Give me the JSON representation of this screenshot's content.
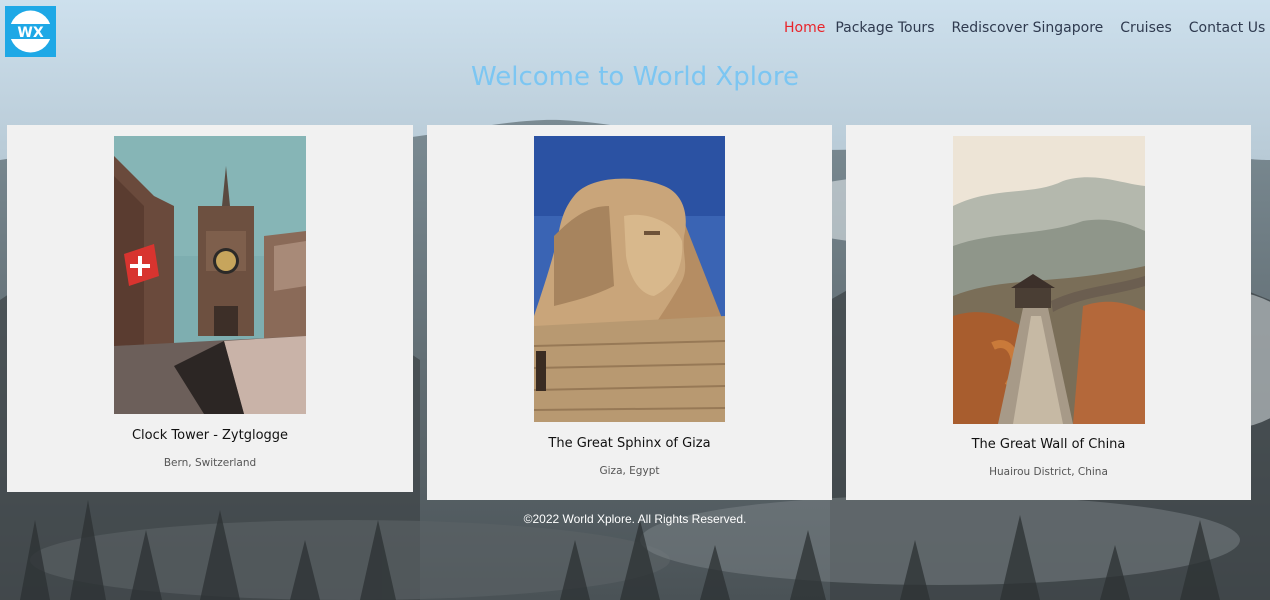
{
  "brand": {
    "logo_text": "WX"
  },
  "nav": {
    "items": [
      {
        "label": "Home",
        "active": true
      },
      {
        "label": "Package Tours"
      },
      {
        "label": "Rediscover Singapore"
      },
      {
        "label": "Cruises"
      },
      {
        "label": "Contact Us"
      }
    ]
  },
  "page": {
    "title": "Welcome to World Xplore"
  },
  "cards": [
    {
      "name": "Clock Tower - Zytglogge",
      "location": "Bern, Switzerland"
    },
    {
      "name": "The Great Sphinx of Giza",
      "location": "Giza, Egypt"
    },
    {
      "name": "The Great Wall of China",
      "location": "Huairou District, China"
    }
  ],
  "footer": {
    "copyright": "©2022 World Xplore. All Rights Reserved."
  },
  "colors": {
    "accent": "#7cc6f2",
    "active_nav": "#e9242a",
    "logo_bg": "#1ea8e6"
  }
}
